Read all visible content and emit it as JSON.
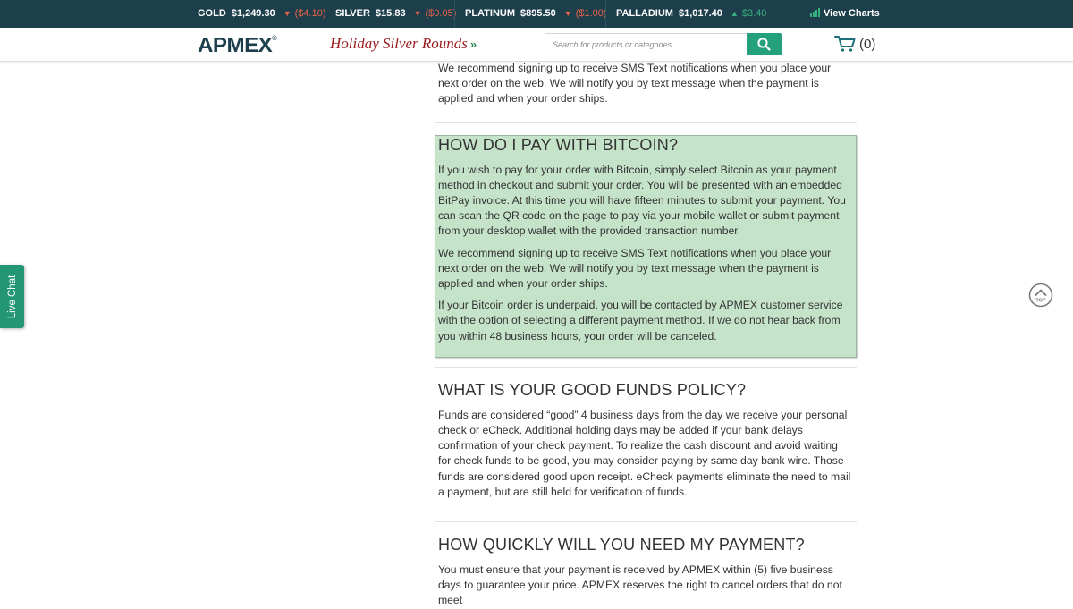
{
  "ticker": {
    "items": [
      {
        "metal": "GOLD",
        "price": "$1,249.30",
        "change": "($4.10)",
        "direction": "down"
      },
      {
        "metal": "SILVER",
        "price": "$15.83",
        "change": "($0.05)",
        "direction": "down"
      },
      {
        "metal": "PLATINUM",
        "price": "$895.50",
        "change": "($1.00)",
        "direction": "down"
      },
      {
        "metal": "PALLADIUM",
        "price": "$1,017.40",
        "change": "$3.40",
        "direction": "up"
      }
    ],
    "view_charts": "View Charts"
  },
  "header": {
    "logo": "APMEX",
    "logo_mark": "®",
    "promo": "Holiday Silver Rounds",
    "promo_arrow": "»",
    "search_placeholder": "Search for products or categories",
    "cart_count": "(0)"
  },
  "colors": {
    "ticker_bg": "#1d3f4c",
    "down": "#e8614a",
    "up": "#37b080",
    "accent": "#24a17a",
    "highlight_bg": "#c5e3c9"
  },
  "content": {
    "top_paragraph": "We recommend signing up to receive SMS Text notifications when you place your next order on the web. We will notify you by text message when the payment is applied and when your order ships.",
    "bitcoin": {
      "title": "HOW DO I PAY WITH BITCOIN?",
      "paragraphs": [
        "If you wish to pay for your order with Bitcoin, simply select Bitcoin as your payment method in checkout and submit your order. You will be presented with an embedded BitPay invoice. At this time you will have fifteen minutes to submit your payment. You can scan the QR code on the page to pay via your mobile wallet or submit payment from your desktop wallet with the provided transaction number.",
        "We recommend signing up to receive SMS Text notifications when you place your next order on the web. We will notify you by text message when the payment is applied and when your order ships.",
        "If your Bitcoin order is underpaid, you will be contacted by APMEX customer service with the option of selecting a different payment method. If we do not hear back from you within 48 business hours, your order will be canceled."
      ]
    },
    "good_funds": {
      "title": "WHAT IS YOUR GOOD FUNDS POLICY?",
      "paragraph": "Funds are considered “good” 4 business days from the day we receive your personal check or eCheck. Additional holding days may be added if your bank delays confirmation of your check payment. To realize the cash discount and avoid waiting for check funds to be good, you may consider paying by same day bank wire. Those funds are considered good upon receipt. eCheck payments eliminate the need to mail a payment, but are still held for verification of funds."
    },
    "payment_timing": {
      "title": "HOW QUICKLY WILL YOU NEED MY PAYMENT?",
      "paragraph": "You must ensure that your payment is received by APMEX within (5) five business days to guarantee your price. APMEX reserves the right to cancel orders that do not meet"
    }
  },
  "widgets": {
    "live_chat": "Live Chat",
    "top_label": "TOP"
  }
}
